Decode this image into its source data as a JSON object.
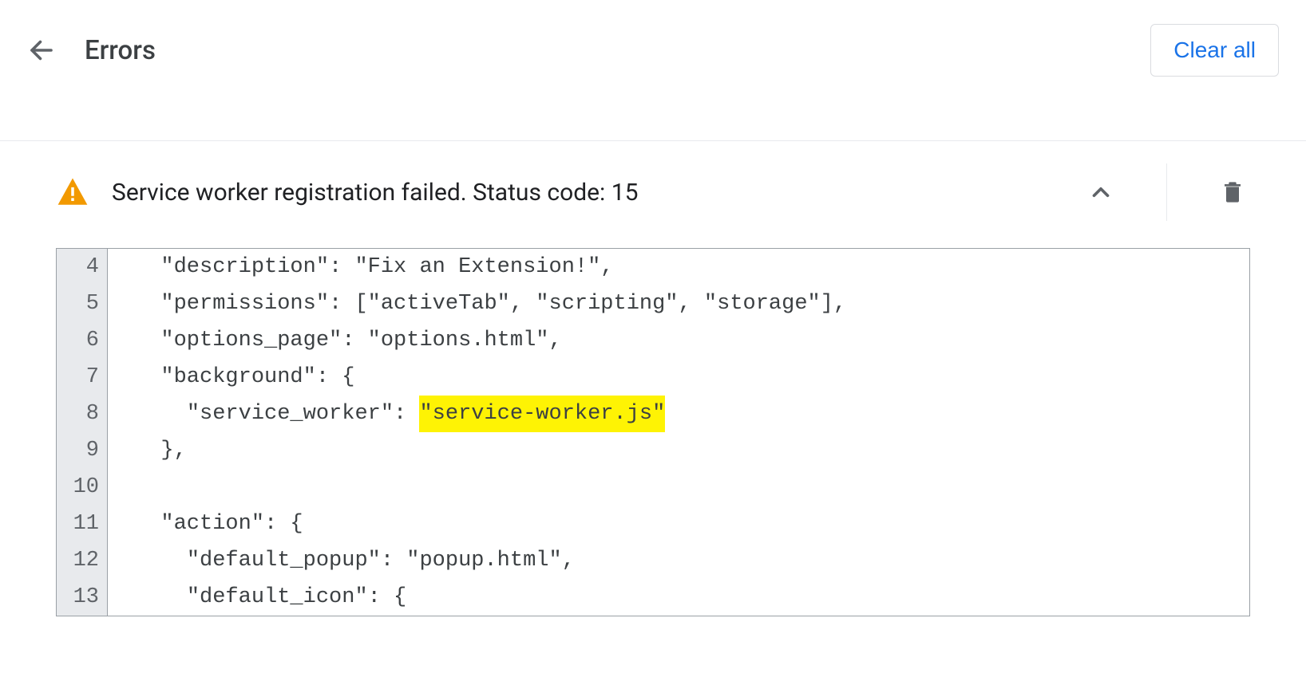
{
  "header": {
    "title": "Errors",
    "clear_all_label": "Clear all"
  },
  "error": {
    "message": "Service worker registration failed. Status code: 15"
  },
  "code": {
    "lines": [
      {
        "num": "4",
        "indent": "  ",
        "pre": "\"description\": \"Fix an Extension!\",",
        "hl": "",
        "post": ""
      },
      {
        "num": "5",
        "indent": "  ",
        "pre": "\"permissions\": [\"activeTab\", \"scripting\", \"storage\"],",
        "hl": "",
        "post": ""
      },
      {
        "num": "6",
        "indent": "  ",
        "pre": "\"options_page\": \"options.html\",",
        "hl": "",
        "post": ""
      },
      {
        "num": "7",
        "indent": "  ",
        "pre": "\"background\": {",
        "hl": "",
        "post": ""
      },
      {
        "num": "8",
        "indent": "    ",
        "pre": "\"service_worker\": ",
        "hl": "\"service-worker.js\"",
        "post": ""
      },
      {
        "num": "9",
        "indent": "  ",
        "pre": "},",
        "hl": "",
        "post": ""
      },
      {
        "num": "10",
        "indent": "",
        "pre": "",
        "hl": "",
        "post": ""
      },
      {
        "num": "11",
        "indent": "  ",
        "pre": "\"action\": {",
        "hl": "",
        "post": ""
      },
      {
        "num": "12",
        "indent": "    ",
        "pre": "\"default_popup\": \"popup.html\",",
        "hl": "",
        "post": ""
      },
      {
        "num": "13",
        "indent": "    ",
        "pre": "\"default_icon\": {",
        "hl": "",
        "post": ""
      }
    ]
  }
}
